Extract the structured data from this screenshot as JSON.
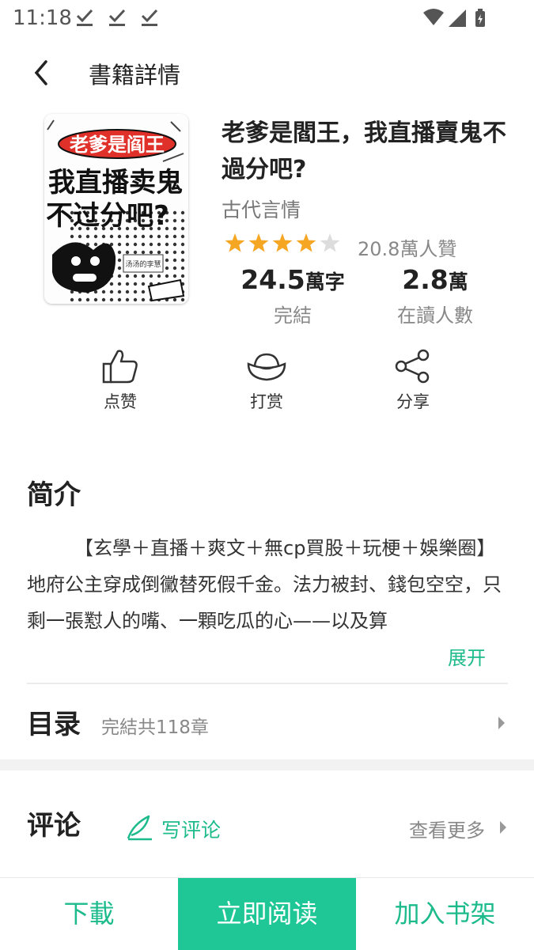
{
  "status": {
    "time": "11:18"
  },
  "header": {
    "title": "書籍詳情"
  },
  "book": {
    "title": "老爹是閻王，我直播賣鬼不過分吧?",
    "category": "古代言情",
    "rating_stars": 4,
    "rating_max": 5,
    "likes": "20.8萬人贊",
    "cover": {
      "badge": "老爹是阎王",
      "line1": "我直播卖鬼",
      "line2": "不过分吧?",
      "author": "汤汤的李慧"
    },
    "words_value": "24.5",
    "words_unit": "萬字",
    "words_label": "完結",
    "readers_value": "2.8",
    "readers_unit": "萬",
    "readers_label": "在讀人數"
  },
  "actions": {
    "like": "点赞",
    "reward": "打赏",
    "share": "分享"
  },
  "intro": {
    "heading": "简介",
    "text": "【玄學＋直播＋爽文＋無cp買股＋玩梗＋娛樂圈】地府公主穿成倒黴替死假千金。法力被封、錢包空空，只剩一張懟人的嘴、一顆吃瓜的心——以及算",
    "expand": "展开"
  },
  "toc": {
    "heading": "目录",
    "meta": "完結共118章"
  },
  "comments": {
    "heading": "评论",
    "write": "写评论",
    "more": "查看更多"
  },
  "bottom": {
    "download": "下載",
    "read": "立即阅读",
    "shelf": "加入书架"
  },
  "colors": {
    "accent": "#1dbb8c",
    "read_button": "#1ec795",
    "star": "#f5a623",
    "star_empty": "#dddddd"
  }
}
